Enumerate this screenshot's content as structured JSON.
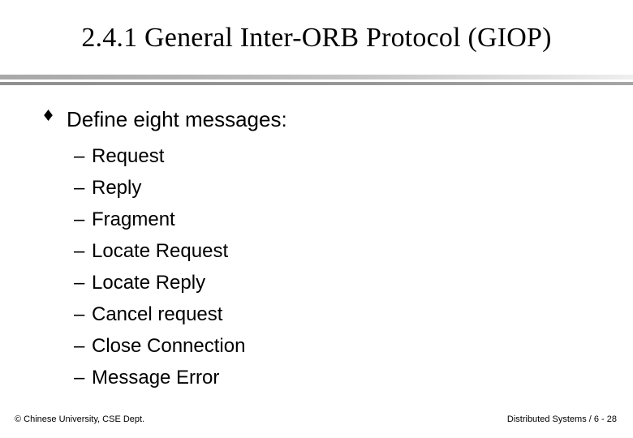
{
  "slide": {
    "title": "2.4.1 General Inter-ORB Protocol (GIOP)",
    "heading": {
      "bullet_glyph": "♦",
      "text": "Define eight messages:"
    },
    "messages": [
      {
        "bullet_glyph": "–",
        "label": "Request"
      },
      {
        "bullet_glyph": "–",
        "label": "Reply"
      },
      {
        "bullet_glyph": "–",
        "label": "Fragment"
      },
      {
        "bullet_glyph": "–",
        "label": "Locate Request"
      },
      {
        "bullet_glyph": "–",
        "label": "Locate Reply"
      },
      {
        "bullet_glyph": "–",
        "label": "Cancel request"
      },
      {
        "bullet_glyph": "–",
        "label": "Close Connection"
      },
      {
        "bullet_glyph": "–",
        "label": "Message Error"
      }
    ],
    "footer": {
      "left": "© Chinese University, CSE Dept.",
      "right": "Distributed Systems / 6 - 28"
    },
    "colors": {
      "text": "#000000",
      "background": "#ffffff",
      "rule_light": "#c9c9c9",
      "rule_dark": "#959595"
    }
  }
}
